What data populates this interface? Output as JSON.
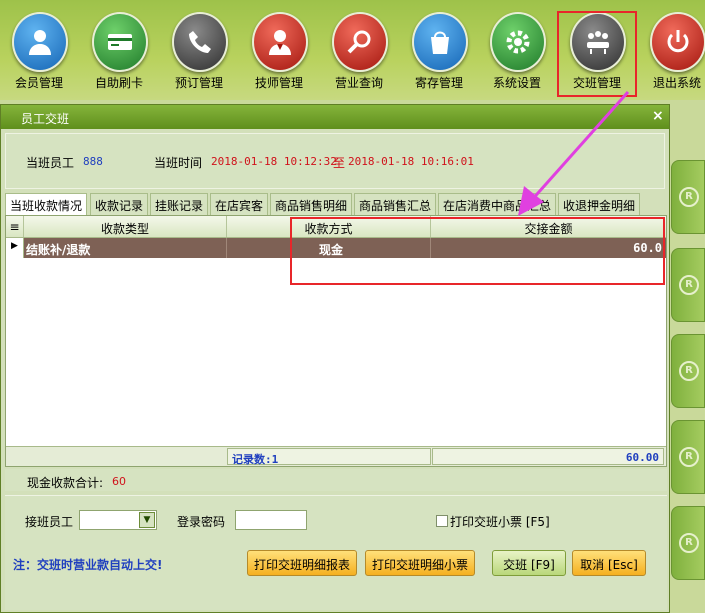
{
  "toolbar": {
    "items": [
      {
        "label": "会员管理",
        "icon": "member-icon",
        "color": "#1f7fd0"
      },
      {
        "label": "自助刷卡",
        "icon": "card-icon",
        "color": "#2e9a3a"
      },
      {
        "label": "预订管理",
        "icon": "phone-icon",
        "color": "#555555"
      },
      {
        "label": "技师管理",
        "icon": "technician-icon",
        "color": "#c8281f"
      },
      {
        "label": "营业查询",
        "icon": "search-icon",
        "color": "#c8281f"
      },
      {
        "label": "寄存管理",
        "icon": "bag-icon",
        "color": "#1f7fd0"
      },
      {
        "label": "系统设置",
        "icon": "gear-icon",
        "color": "#2e9a3a"
      },
      {
        "label": "交班管理",
        "icon": "meeting-icon",
        "color": "#555555"
      },
      {
        "label": "退出系统",
        "icon": "power-icon",
        "color": "#c8281f"
      }
    ]
  },
  "dialog": {
    "title": "员工交班",
    "close": "×",
    "duty_staff_label": "当班员工",
    "duty_staff_value": "888",
    "duty_time_label": "当班时间",
    "start_time": "2018-01-18 10:12:32",
    "to_label": "至",
    "end_time": "2018-01-18 10:16:01"
  },
  "tabs": [
    "当班收款情况",
    "收款记录",
    "挂账记录",
    "在店宾客",
    "商品销售明细",
    "商品销售汇总",
    "在店消费中商品汇总",
    "收退押金明细"
  ],
  "grid": {
    "columns": [
      "收款类型",
      "收款方式",
      "交接金额"
    ],
    "rows": [
      {
        "type": "结账补/退款",
        "method": "现金",
        "amount": "60.0"
      }
    ],
    "footer_count": "记录数:1",
    "footer_total": "60.00"
  },
  "cash_total": {
    "label": "现金收款合计:",
    "value": "60"
  },
  "form": {
    "receiver_label": "接班员工",
    "password_label": "登录密码",
    "print_ticket_label": "打印交班小票 [F5]",
    "note": "注：交班时营业款自动上交!",
    "btn_print_report": "打印交班明细报表",
    "btn_print_ticket": "打印交班明细小票",
    "btn_shift": "交班 [F9]",
    "btn_cancel": "取消 [Esc]"
  },
  "colors": {
    "accent": "#e8262a",
    "arrow": "#e040e0",
    "row_bg": "#7e6155"
  }
}
